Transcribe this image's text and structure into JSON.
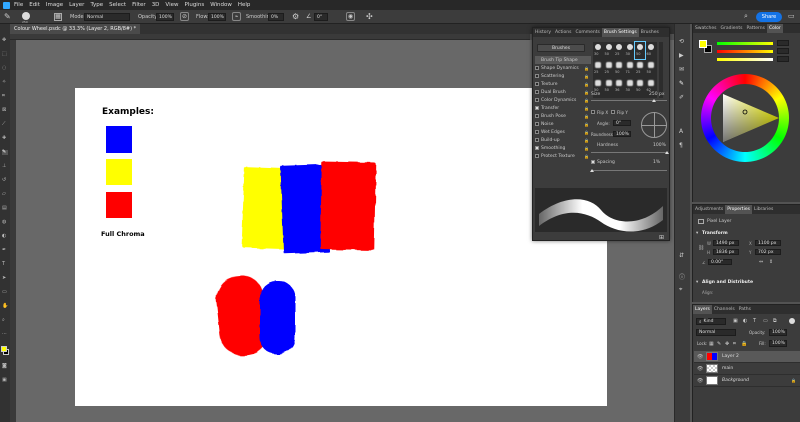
{
  "menu": [
    "File",
    "Edit",
    "Image",
    "Layer",
    "Type",
    "Select",
    "Filter",
    "3D",
    "View",
    "Plugins",
    "Window",
    "Help"
  ],
  "options": {
    "mode_label": "Mode:",
    "mode_value": "Normal",
    "opacity_label": "Opacity:",
    "opacity_value": "100%",
    "flow_label": "Flow:",
    "flow_value": "100%",
    "smoothing_label": "Smoothing:",
    "smoothing_value": "0%",
    "angle_value": "0°",
    "share_label": "Share",
    "brush_size": "250"
  },
  "document_tab": "Colour Wheel.psdc @ 33.3% (Layer 2, RGB/8#) *",
  "canvas": {
    "heading": "Examples:",
    "footer": "Full Chroma",
    "colors": {
      "blue": "#0000ff",
      "yellow": "#ffff00",
      "red": "#ff0000"
    }
  },
  "brush_panel": {
    "tabs": [
      "History",
      "Actions",
      "Comments",
      "Brush Settings",
      "Brushes"
    ],
    "brushes_button": "Brushes",
    "items": [
      {
        "label": "Brush Tip Shape",
        "check": null,
        "lock": false
      },
      {
        "label": "Shape Dynamics",
        "check": false,
        "lock": true
      },
      {
        "label": "Scattering",
        "check": false,
        "lock": true
      },
      {
        "label": "Texture",
        "check": false,
        "lock": true
      },
      {
        "label": "Dual Brush",
        "check": false,
        "lock": true
      },
      {
        "label": "Color Dynamics",
        "check": false,
        "lock": true
      },
      {
        "label": "Transfer",
        "check": true,
        "lock": true
      },
      {
        "label": "Brush Pose",
        "check": false,
        "lock": true
      },
      {
        "label": "Noise",
        "check": false,
        "lock": true
      },
      {
        "label": "Wet Edges",
        "check": false,
        "lock": true
      },
      {
        "label": "Build-up",
        "check": false,
        "lock": true
      },
      {
        "label": "Smoothing",
        "check": true,
        "lock": true
      },
      {
        "label": "Protect Texture",
        "check": false,
        "lock": true
      }
    ],
    "tip_sizes": [
      "30",
      "50",
      "25",
      "30",
      "50",
      "60",
      "25",
      "25",
      "50",
      "71",
      "25",
      "50",
      "50",
      "50",
      "36",
      "30",
      "50",
      "62"
    ],
    "size_label": "Size",
    "size_value": "250 px",
    "flipx_label": "Flip X",
    "flipy_label": "Flip Y",
    "angle_label": "Angle:",
    "angle_value": "0°",
    "roundness_label": "Roundness:",
    "roundness_value": "100%",
    "hardness_label": "Hardness",
    "hardness_value": "100%",
    "spacing_label": "Spacing",
    "spacing_value": "1%"
  },
  "color_panel": {
    "tabs": [
      "Swatches",
      "Gradients",
      "Patterns",
      "Color"
    ],
    "fg": "#ffff00",
    "bg": "#000000"
  },
  "properties": {
    "tabs": [
      "Adjustments",
      "Properties",
      "Libraries"
    ],
    "layer_type": "Pixel Layer",
    "transform_label": "Transform",
    "w": "1490 px",
    "h": "1836 px",
    "x": "1100 px",
    "y": "702 px",
    "angle": "0.00°",
    "align_label": "Align and Distribute",
    "align_sub": "Align:"
  },
  "layers": {
    "tabs": [
      "Layers",
      "Channels",
      "Paths"
    ],
    "kind": "Kind",
    "blend": "Normal",
    "opacity_label": "Opacity:",
    "opacity": "100%",
    "lock_label": "Lock:",
    "fill_label": "Fill:",
    "fill": "100%",
    "items": [
      {
        "name": "Layer 2",
        "selected": true
      },
      {
        "name": "main",
        "selected": false
      },
      {
        "name": "Background",
        "selected": false
      }
    ]
  }
}
